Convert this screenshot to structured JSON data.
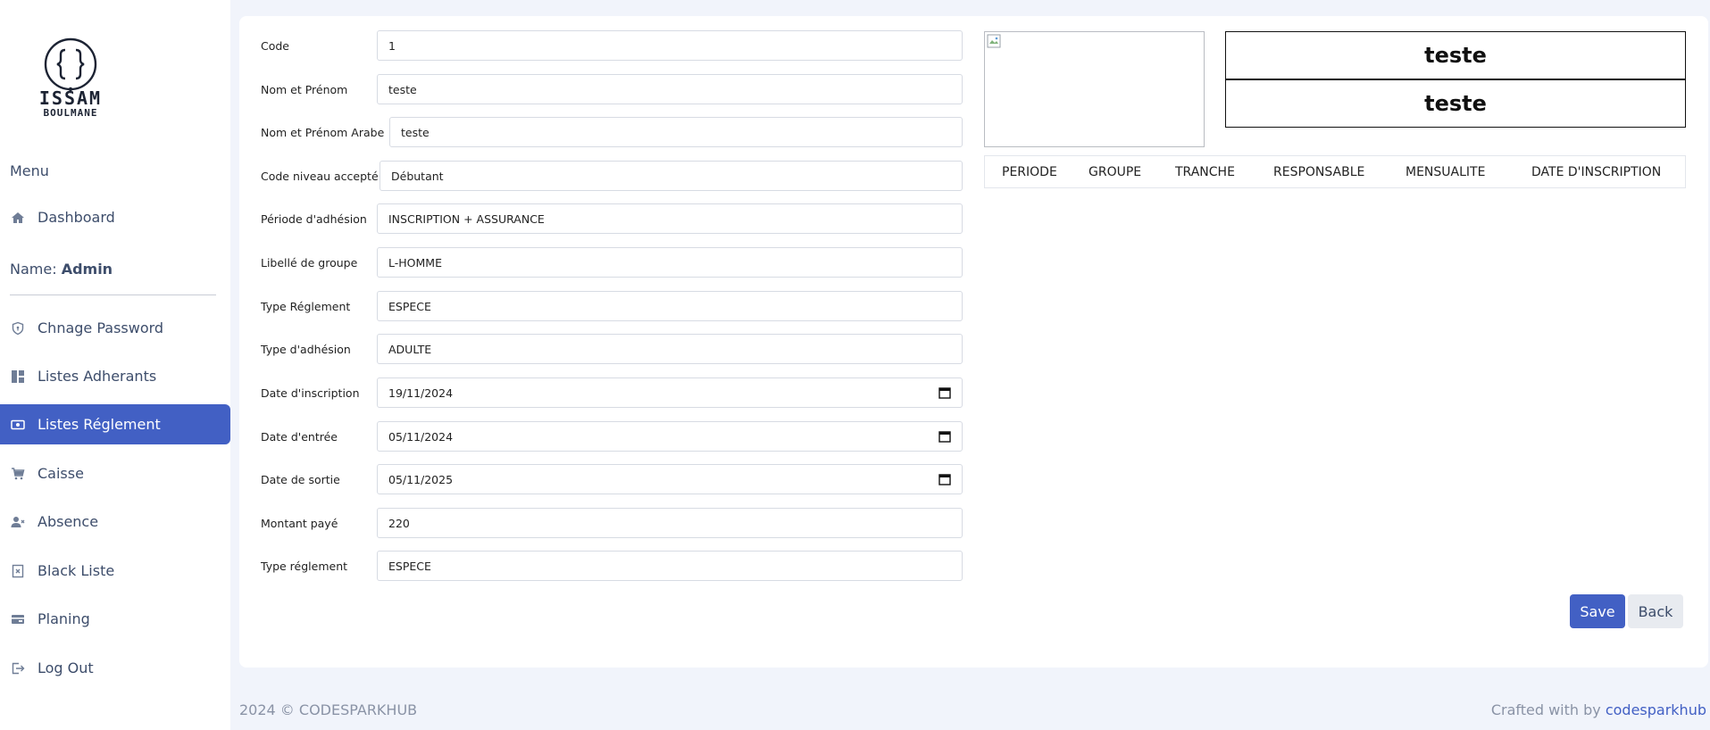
{
  "sidebar": {
    "logo_text_main": "ISSAM",
    "logo_text_sub": "BOULMANE",
    "menu_title": "Menu",
    "dashboard": "Dashboard",
    "name_label": "Name:",
    "name_value": "Admin",
    "items": [
      {
        "label": "Chnage Password",
        "icon": "shield-icon"
      },
      {
        "label": "Listes Adherants",
        "icon": "dashboard-icon"
      },
      {
        "label": "Listes Réglement",
        "icon": "money-icon",
        "active": true
      },
      {
        "label": "Caisse",
        "icon": "cart-icon"
      },
      {
        "label": "Absence",
        "icon": "user-x-icon"
      },
      {
        "label": "Black Liste",
        "icon": "building-x-icon"
      },
      {
        "label": "Planing",
        "icon": "wallet-icon"
      },
      {
        "label": "Log Out",
        "icon": "logout-icon"
      }
    ]
  },
  "form": {
    "code": {
      "label": "Code",
      "value": "1"
    },
    "nom": {
      "label": "Nom et Prénom",
      "value": "teste"
    },
    "nom_arabe": {
      "label": "Nom et Prénom Arabe",
      "value": "teste"
    },
    "niveau": {
      "label": "Code niveau accepté",
      "value": "Débutant"
    },
    "periode": {
      "label": "Période d'adhésion",
      "value": "INSCRIPTION + ASSURANCE"
    },
    "groupe": {
      "label": "Libellé de groupe",
      "value": "L-HOMME"
    },
    "type_reglement": {
      "label": "Type Réglement",
      "value": "ESPECE"
    },
    "type_adhesion": {
      "label": "Type d'adhésion",
      "value": "ADULTE"
    },
    "date_inscription": {
      "label": "Date d'inscription",
      "value": "19/11/2024"
    },
    "date_entree": {
      "label": "Date d'entrée",
      "value": "05/11/2024"
    },
    "date_sortie": {
      "label": "Date de sortie",
      "value": "05/11/2025"
    },
    "montant": {
      "label": "Montant payé",
      "value": "220"
    },
    "type_reglement2": {
      "label": "Type réglement",
      "value": "ESPECE"
    }
  },
  "profile": {
    "name_latin": "teste",
    "name_arabic": "teste"
  },
  "table": {
    "columns": [
      "PERIODE",
      "GROUPE",
      "TRANCHE",
      "RESPONSABLE",
      "MENSUALITE",
      "DATE D'INSCRIPTION"
    ]
  },
  "actions": {
    "save": "Save",
    "back": "Back"
  },
  "footer": {
    "copyright": "2024 © CODESPARKHUB",
    "crafted_prefix": "Crafted with by",
    "crafted_brand": "codesparkhub"
  }
}
